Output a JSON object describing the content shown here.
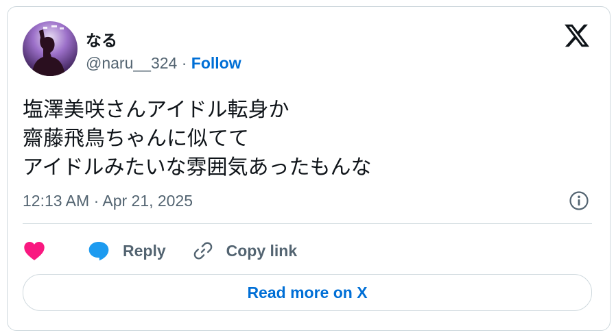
{
  "author": {
    "display_name": "なる",
    "handle": "@naru__324",
    "separator": " · ",
    "follow_label": "Follow"
  },
  "icons": {
    "avatar": "avatar",
    "brand": "x-logo-icon",
    "info": "info-icon",
    "like": "heart-icon",
    "reply": "speech-bubble-icon",
    "copy": "link-icon"
  },
  "tweet": {
    "lines": [
      "塩澤美咲さんアイドル転身か",
      "齋藤飛鳥ちゃんに似てて",
      "アイドルみたいな雰囲気あったもんな"
    ],
    "timestamp": "12:13 AM · Apr 21, 2025"
  },
  "actions": {
    "reply_label": "Reply",
    "copy_label": "Copy link"
  },
  "read_more_label": "Read more on X",
  "colors": {
    "text": "#0f1419",
    "secondary": "#536471",
    "link": "#006fd6",
    "like": "#f91880",
    "reply": "#1d9bf0",
    "border": "#cfd9de"
  }
}
